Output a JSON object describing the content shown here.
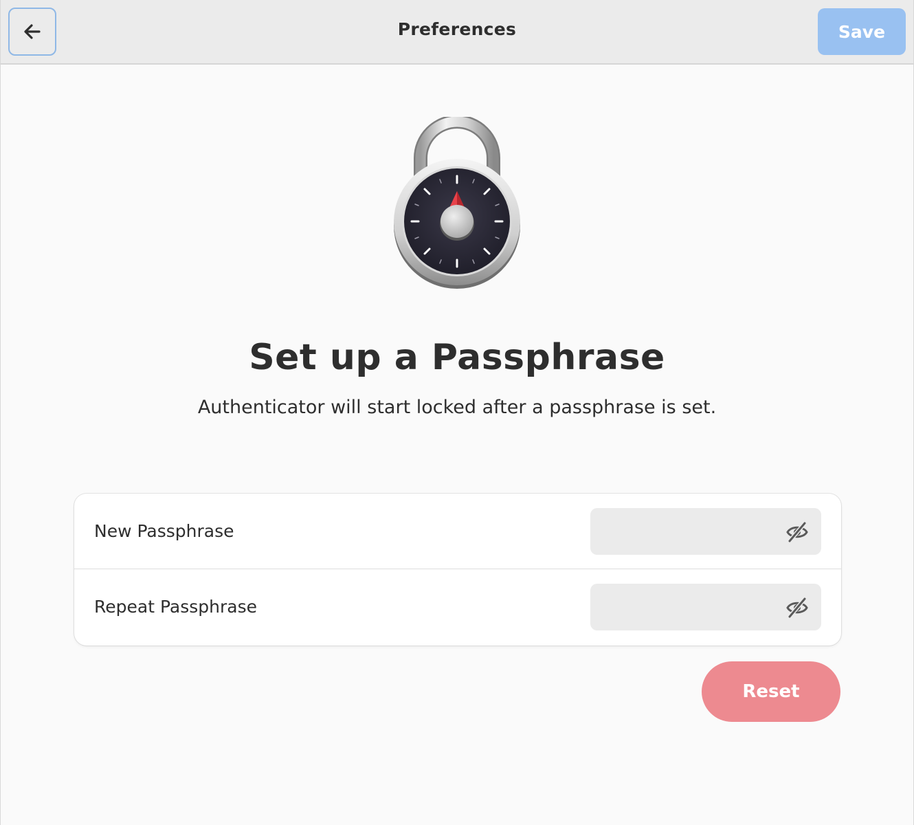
{
  "header": {
    "title": "Preferences",
    "back_icon": "arrow-left-icon",
    "save_label": "Save"
  },
  "main": {
    "heading": "Set up a Passphrase",
    "subtitle": "Authenticator will start locked after a passphrase is set.",
    "illustration_icon": "padlock-icon"
  },
  "form": {
    "rows": [
      {
        "label": "New Passphrase",
        "value": "",
        "toggle_icon": "eye-crossed-icon"
      },
      {
        "label": "Repeat Passphrase",
        "value": "",
        "toggle_icon": "eye-crossed-icon"
      }
    ],
    "reset_label": "Reset"
  },
  "colors": {
    "accent": "#99c1f1",
    "destructive": "#ed8a90",
    "header_bg": "#ebebeb",
    "page_bg": "#fafafa"
  }
}
